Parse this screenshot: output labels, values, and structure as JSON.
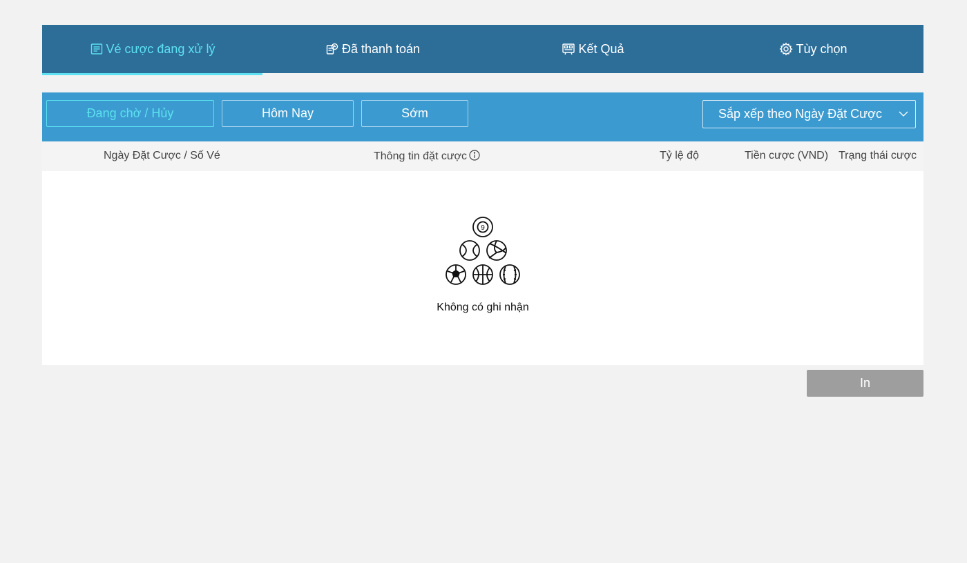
{
  "tabs": [
    {
      "label": "Vé cược đang xử lý",
      "icon": "ticket-list-icon",
      "active": true
    },
    {
      "label": "Đã thanh toán",
      "icon": "paid-coins-icon",
      "active": false
    },
    {
      "label": "Kết Quả",
      "icon": "results-board-icon",
      "active": false
    },
    {
      "label": "Tùy chọn",
      "icon": "gear-icon",
      "active": false
    }
  ],
  "filters": {
    "pending_cancel": "Đang chờ / Hủy",
    "today": "Hôm Nay",
    "early": "Sớm",
    "active": "pending_cancel"
  },
  "sort": {
    "label": "Sắp xếp theo Ngày Đặt Cược"
  },
  "table": {
    "columns": [
      "Ngày Đặt Cược / Số Vé",
      "Thông tin đặt cược",
      "Tỷ lệ độ",
      "Tiền cược (VND)",
      "Trạng thái cược"
    ]
  },
  "empty": {
    "message": "Không có ghi nhận",
    "icon": "sports-balls-icon"
  },
  "print_label": "In",
  "colors": {
    "tabbar": "#2d6e99",
    "filterbar": "#3b9bd0",
    "accent": "#5de0f0",
    "print_button": "#9e9e9e"
  }
}
